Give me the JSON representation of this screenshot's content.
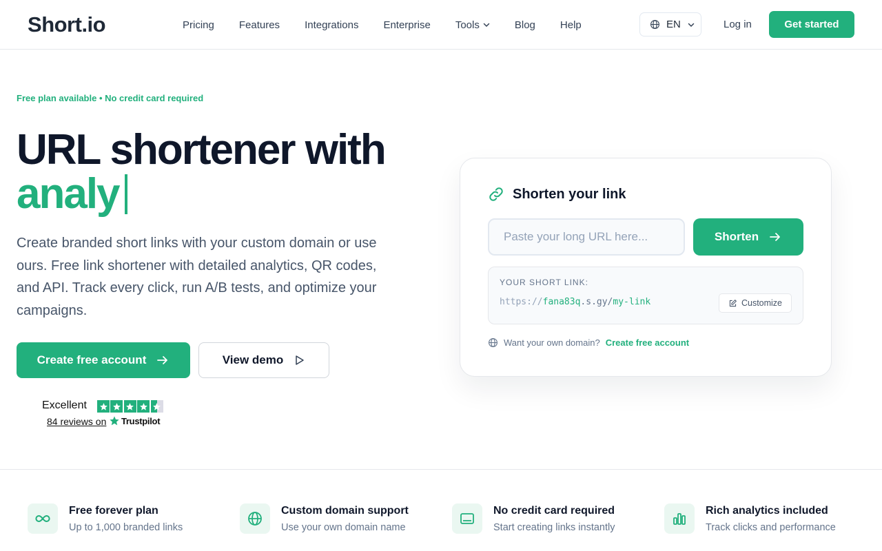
{
  "brand": {
    "logo_prefix": "S",
    "logo_rest": "hort.io",
    "accent": "#22b07d"
  },
  "nav": {
    "items": [
      {
        "label": "Pricing"
      },
      {
        "label": "Features"
      },
      {
        "label": "Integrations"
      },
      {
        "label": "Enterprise"
      },
      {
        "label": "Tools"
      },
      {
        "label": "Blog"
      },
      {
        "label": "Help"
      }
    ],
    "language": "EN",
    "login": "Log in",
    "cta": "Get started"
  },
  "hero": {
    "tagline": "Free plan available • No credit card required",
    "title_line1": "URL shortener with",
    "title_line2": "analy",
    "description": "Create branded short links with your custom domain or use ours. Free link shortener with detailed analytics, QR codes, and API. Track every click, run A/B tests, and optimize your campaigns.",
    "primary_button": "Create free account",
    "secondary_button": "View demo"
  },
  "trustpilot": {
    "rating_word": "Excellent",
    "stars": 4.5,
    "reviews_text": "84 reviews on",
    "brand": "Trustpilot"
  },
  "shorten_card": {
    "title": "Shorten your link",
    "input_placeholder": "Paste your long URL here...",
    "button": "Shorten",
    "result_label": "YOUR SHORT LINK:",
    "result_protocol": "https://",
    "result_subdomain": "fana83q",
    "result_dot_domain": ".s.gy/",
    "result_path": "my-link",
    "customize": "Customize",
    "domain_hint": "Want your own domain?",
    "domain_link": "Create free account"
  },
  "features": [
    {
      "icon": "infinity-icon",
      "title": "Free forever plan",
      "subtitle": "Up to 1,000 branded links"
    },
    {
      "icon": "globe-icon",
      "title": "Custom domain support",
      "subtitle": "Use your own domain name"
    },
    {
      "icon": "credit-card-icon",
      "title": "No credit card required",
      "subtitle": "Start creating links instantly"
    },
    {
      "icon": "bar-chart-icon",
      "title": "Rich analytics included",
      "subtitle": "Track clicks and performance"
    }
  ]
}
